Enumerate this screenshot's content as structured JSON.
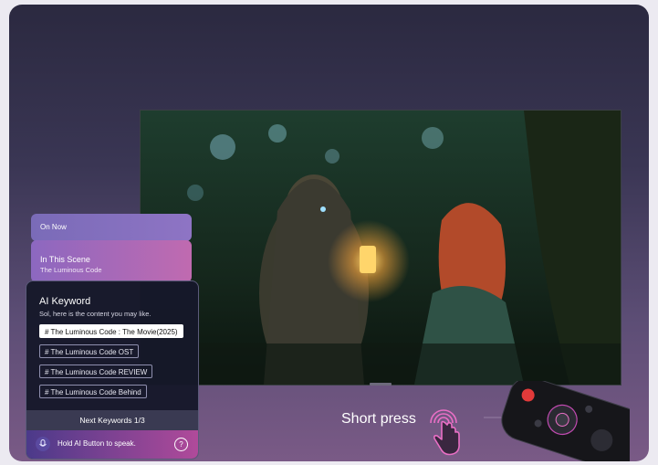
{
  "panels": {
    "on_now": "On Now",
    "in_this_scene": {
      "title": "In This Scene",
      "subtitle": "The Luminous Code"
    }
  },
  "ai_keyword": {
    "title": "AI Keyword",
    "subtitle": "Sol, here is the content you may like.",
    "keywords": [
      "# The Luminous Code : The Movie(2025)",
      "# The Luminous Code  OST",
      "# The Luminous Code  REVIEW",
      "# The Luminous Code  Behind"
    ],
    "next_keywords": "Next Keywords 1/3",
    "voice_hint": "Hold AI Button to speak.",
    "help": "?"
  },
  "caption": "Short press",
  "icons": [
    "microphone-icon",
    "help-icon",
    "tap-hand-icon",
    "remote-control-icon"
  ],
  "colors": {
    "accent": "#b04a9a",
    "selected_chip": "#ffffff",
    "remote_red": "#e23a3a"
  }
}
